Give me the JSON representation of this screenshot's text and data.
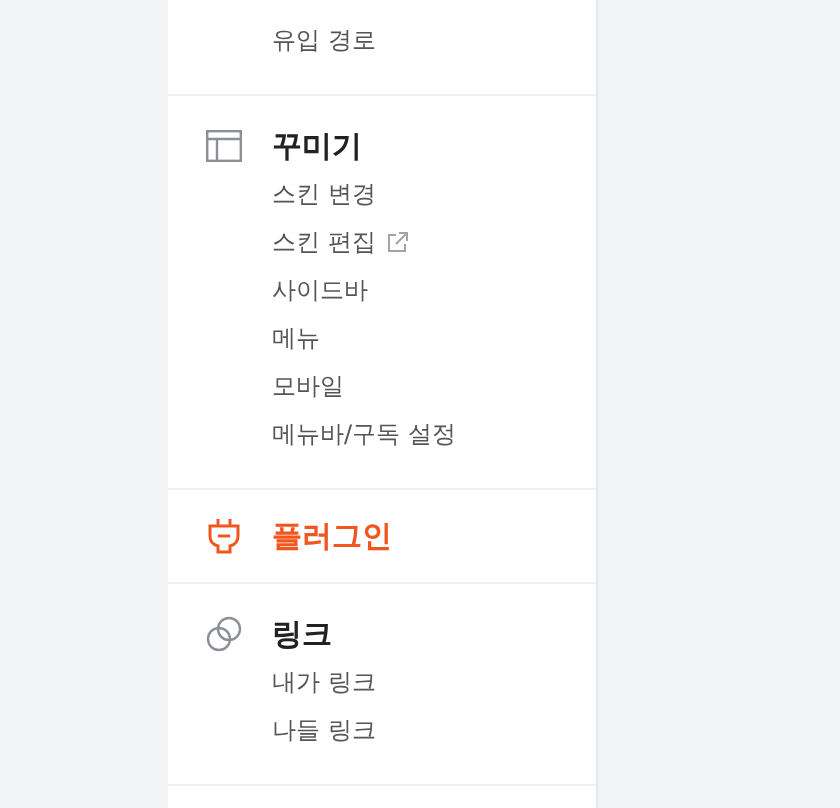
{
  "sections": [
    {
      "items": [
        {
          "label": "유입 경로",
          "external": false
        }
      ]
    },
    {
      "title": "꾸미기",
      "kind": "layout",
      "selected": false,
      "items": [
        {
          "label": "스킨 변경",
          "external": false
        },
        {
          "label": "스킨 편집",
          "external": true
        },
        {
          "label": "사이드바",
          "external": false
        },
        {
          "label": "메뉴",
          "external": false
        },
        {
          "label": "모바일",
          "external": false
        },
        {
          "label": "메뉴바/구독 설정",
          "external": false
        }
      ]
    },
    {
      "title": "플러그인",
      "kind": "plug",
      "selected": true
    },
    {
      "title": "링크",
      "kind": "link",
      "selected": false,
      "items": [
        {
          "label": "내가 링크",
          "external": false
        },
        {
          "label": "나들 링크",
          "external": false
        }
      ]
    }
  ]
}
